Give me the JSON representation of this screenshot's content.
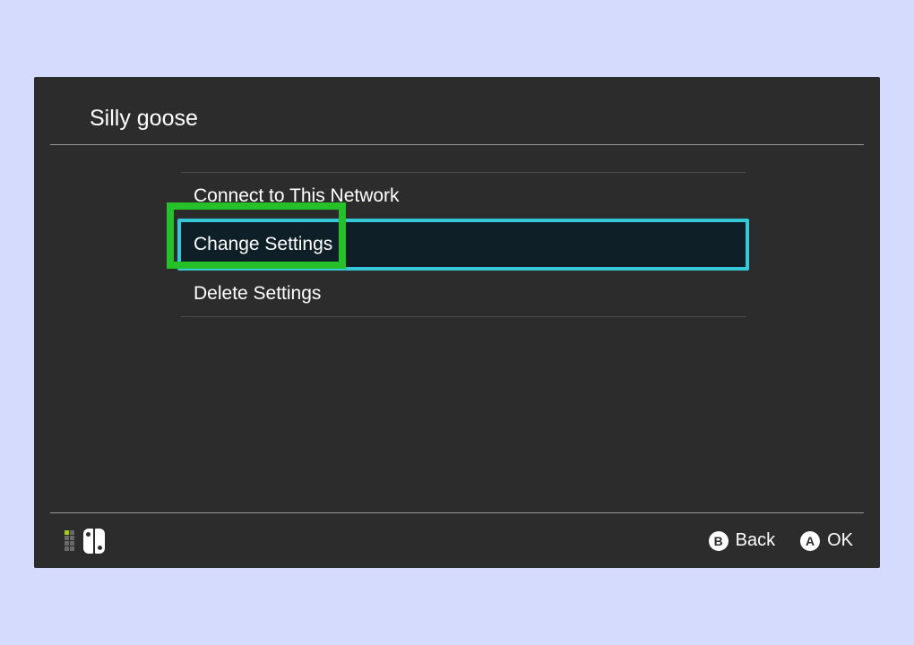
{
  "header": {
    "title": "Silly goose"
  },
  "menu": {
    "items": [
      {
        "label": "Connect to This Network",
        "selected": false
      },
      {
        "label": "Change Settings",
        "selected": true
      },
      {
        "label": "Delete Settings",
        "selected": false
      }
    ]
  },
  "footer": {
    "back": {
      "button": "B",
      "label": "Back"
    },
    "ok": {
      "button": "A",
      "label": "OK"
    }
  }
}
